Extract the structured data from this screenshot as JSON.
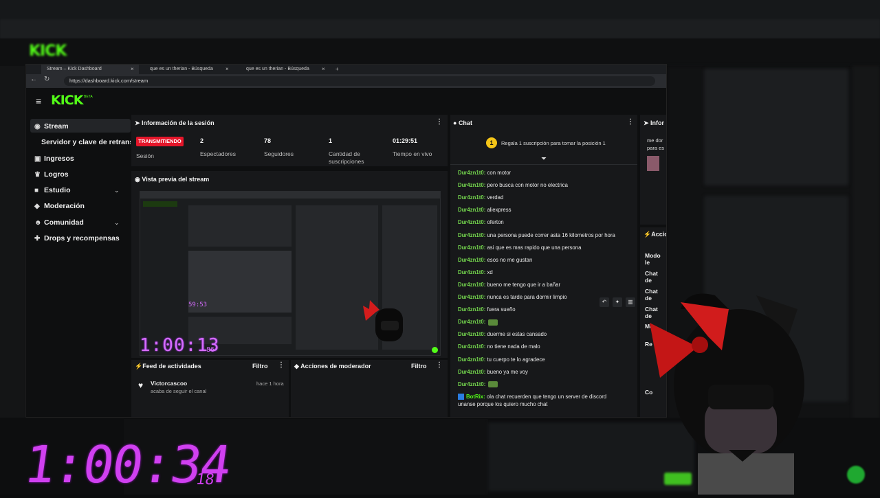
{
  "browser": {
    "tabs": [
      {
        "label": "Stream – Kick Dashboard"
      },
      {
        "label": "que es un therian - Búsqueda"
      },
      {
        "label": "que es un therian - Búsqueda"
      }
    ],
    "url": "https://dashboard.kick.com/stream",
    "new_tab": "+",
    "close_icon": "×"
  },
  "app": {
    "logo": "KICK",
    "beta": "BETA"
  },
  "sidebar": {
    "items": [
      {
        "label": "Stream",
        "icon": "signal-icon"
      },
      {
        "label": "Servidor y clave de retransmisión",
        "icon": ""
      },
      {
        "label": "Ingresos",
        "icon": "wallet-icon"
      },
      {
        "label": "Logros",
        "icon": "trophy-icon"
      },
      {
        "label": "Estudio",
        "icon": "camera-icon"
      },
      {
        "label": "Moderación",
        "icon": "shield-icon"
      },
      {
        "label": "Comunidad",
        "icon": "people-icon"
      },
      {
        "label": "Drops y recompensas",
        "icon": "gift-icon"
      }
    ]
  },
  "session": {
    "title": "Información de la sesión",
    "status_badge": "TRANSMITIENDO",
    "status_label": "Sesión",
    "viewers": "2",
    "viewers_label": "Espectadores",
    "followers": "78",
    "followers_label": "Seguidores",
    "subs": "1",
    "subs_label": "Cantidad de suscripciones",
    "uptime": "01:29:51",
    "uptime_label": "Tiempo en vivo"
  },
  "preview": {
    "title": "Vista previa del stream",
    "timer": "1:00:13",
    "timer_small": "86",
    "inner_timer": "59:53"
  },
  "feed": {
    "title": "Feed de actividades",
    "filter": "Filtro",
    "entries": [
      {
        "name": "Victorcascoo",
        "text": "acaba de seguir el canal",
        "time": "hace 1 hora"
      }
    ]
  },
  "mod": {
    "title": "Acciones de moderador",
    "filter": "Filtro"
  },
  "chat": {
    "title": "Chat",
    "pinned": "Regala 1 suscripción para tomar la posición 1",
    "pinned_rank": "1",
    "messages": [
      {
        "user": "Dur4zn1t0:",
        "text": " con motor"
      },
      {
        "user": "Dur4zn1t0:",
        "text": " pero busca con motor no electrica"
      },
      {
        "user": "Dur4zn1t0:",
        "text": " verdad"
      },
      {
        "user": "Dur4zn1t0:",
        "text": " aliexpress"
      },
      {
        "user": "Dur4zn1t0:",
        "text": " oferton"
      },
      {
        "user": "Dur4zn1t0:",
        "text": " una persona puede correr asta 16 kilometros por hora"
      },
      {
        "user": "Dur4zn1t0:",
        "text": " asi que es mas rapido que una persona"
      },
      {
        "user": "Dur4zn1t0:",
        "text": " esos no me gustan"
      },
      {
        "user": "Dur4zn1t0:",
        "text": " xd"
      },
      {
        "user": "Dur4zn1t0:",
        "text": " bueno me tengo que ir a bañar"
      },
      {
        "user": "Dur4zn1t0:",
        "text": " nunca es tarde para dormir limpio"
      },
      {
        "user": "Dur4zn1t0:",
        "text": " fuera sueño"
      },
      {
        "user": "Dur4zn1t0:",
        "text": ""
      },
      {
        "user": "Dur4zn1t0:",
        "text": " duerme si estas cansado"
      },
      {
        "user": "Dur4zn1t0:",
        "text": " no tiene nada de malo"
      },
      {
        "user": "Dur4zn1t0:",
        "text": " tu cuerpo te lo agradece"
      },
      {
        "user": "Dur4zn1t0:",
        "text": " bueno ya me voy"
      },
      {
        "user": "Dur4zn1t0:",
        "text": ""
      }
    ],
    "bot": {
      "user": "BotRix:",
      "text": " ola chat recuerden que tengo un server de discord",
      "text2": "unanse porque los quiero mucho chat"
    }
  },
  "right_panel": {
    "title": "Infor",
    "snippet1": "me dor",
    "snippet2": "para es",
    "actions_title": "Accio",
    "rows": [
      "Modo le",
      "Chat de",
      "Chat de",
      "Chat de",
      "Mo",
      "Re",
      "Co"
    ]
  },
  "overlay": {
    "big_timer": "1:00:34",
    "big_timer_small": "18"
  },
  "colors": {
    "brand": "#53fc18",
    "live": "#e5162a",
    "timer": "#d040f0"
  }
}
